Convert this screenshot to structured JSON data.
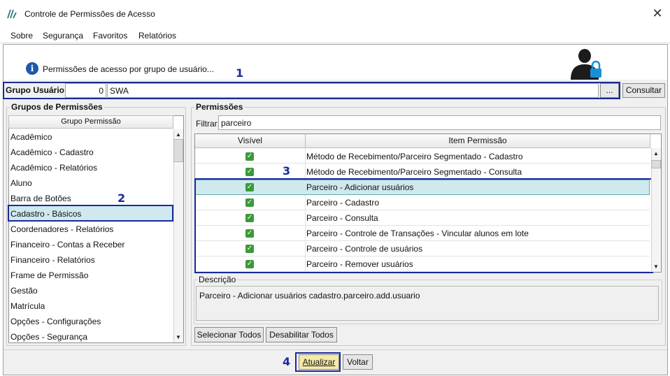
{
  "window": {
    "title": "Controle de Permissões de Acesso",
    "close_glyph": "✕"
  },
  "menu": [
    "Sobre",
    "Segurança",
    "Favoritos",
    "Relatórios"
  ],
  "header": {
    "info_text": "Permissões de acesso por grupo de usuário..."
  },
  "markers": [
    "1",
    "2",
    "3",
    "4"
  ],
  "grupo_usuario": {
    "label": "Grupo Usuário:",
    "code": "0",
    "name": "SWA",
    "lookup_label": "...",
    "consultar_label": "Consultar"
  },
  "grupos": {
    "title": "Grupos de Permissões",
    "column_header": "Grupo Permissão",
    "items": [
      "Acadêmico",
      "Acadêmico - Cadastro",
      "Acadêmico - Relatórios",
      "Aluno",
      "Barra de Botões",
      "Cadastro - Básicos",
      "Coordenadores - Relatórios",
      "Financeiro - Contas a Receber",
      "Financeiro - Relatórios",
      "Frame de Permissão",
      "Gestão",
      "Matrícula",
      "Opções - Configurações",
      "Opções - Segurança"
    ],
    "selected": "Cadastro - Básicos"
  },
  "permissoes": {
    "title": "Permissões",
    "filter_label": "Filtrar:",
    "filter_value": "parceiro",
    "col_visivel": "Visível",
    "col_item": "Item Permissão",
    "rows": [
      "Método de Recebimento/Parceiro Segmentado - Cadastro",
      "Método de Recebimento/Parceiro Segmentado - Consulta",
      "Parceiro - Adicionar usuários",
      "Parceiro - Cadastro",
      "Parceiro - Consulta",
      "Parceiro - Controle de Transações - Vincular alunos em lote",
      "Parceiro - Controle de usuários",
      "Parceiro - Remover usuários"
    ],
    "selected": "Parceiro - Adicionar usuários"
  },
  "descricao": {
    "title": "Descrição",
    "text": "Parceiro - Adicionar usuários cadastro.parceiro.add.usuario"
  },
  "buttons": {
    "select_all": "Selecionar Todos",
    "disable_all": "Desabilitar Todos",
    "update": "Atualizar",
    "back": "Voltar"
  },
  "colors": {
    "accent_marker": "#1a2a9a",
    "selection": "#cfe9ee",
    "update_button": "#f5e9a8",
    "check": "#3a9a3a"
  }
}
